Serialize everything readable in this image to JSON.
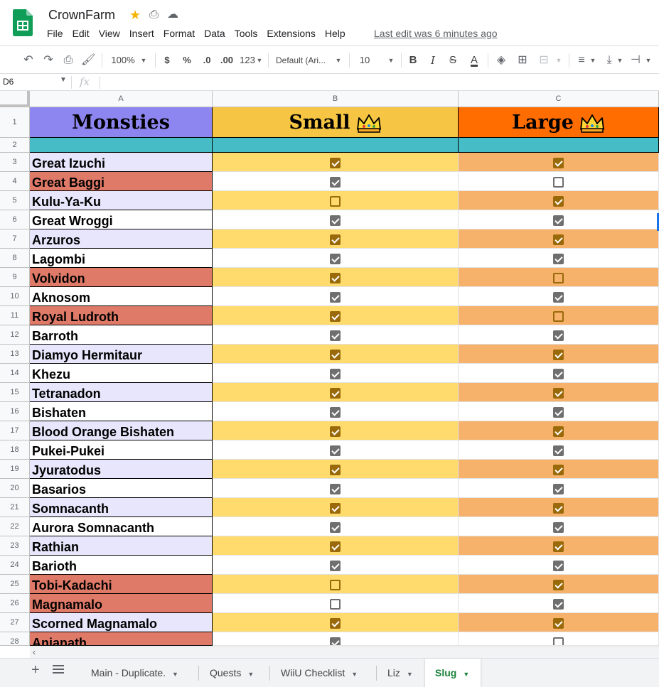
{
  "header": {
    "doc_title": "CrownFarm",
    "menu": [
      "File",
      "Edit",
      "View",
      "Insert",
      "Format",
      "Data",
      "Tools",
      "Extensions",
      "Help"
    ],
    "last_edit": "Last edit was 6 minutes ago"
  },
  "toolbar": {
    "zoom": "100%",
    "currency": "$",
    "percent": "%",
    "decrease_decimal": ".0",
    "increase_decimal": ".00",
    "number_format": "123",
    "font": "Default (Ari...",
    "font_size": "10",
    "bold": "B",
    "italic": "I",
    "strike": "S",
    "text_color": "A"
  },
  "formula_bar": {
    "name_box": "D6",
    "fx": "fx"
  },
  "columns": [
    "A",
    "B",
    "C"
  ],
  "sheet": {
    "header_row": {
      "a": "Monsties",
      "b": "Small",
      "c": "Large"
    },
    "rows": [
      {
        "num": "3",
        "name": "Great Izuchi",
        "small": true,
        "large": true,
        "red": false
      },
      {
        "num": "4",
        "name": "Great Baggi",
        "small": true,
        "large": false,
        "red": true
      },
      {
        "num": "5",
        "name": "Kulu-Ya-Ku",
        "small": false,
        "large": true,
        "red": false
      },
      {
        "num": "6",
        "name": "Great Wroggi",
        "small": true,
        "large": true,
        "red": false
      },
      {
        "num": "7",
        "name": "Arzuros",
        "small": true,
        "large": true,
        "red": false
      },
      {
        "num": "8",
        "name": "Lagombi",
        "small": true,
        "large": true,
        "red": false
      },
      {
        "num": "9",
        "name": "Volvidon",
        "small": true,
        "large": false,
        "red": true
      },
      {
        "num": "10",
        "name": "Aknosom",
        "small": true,
        "large": true,
        "red": false
      },
      {
        "num": "11",
        "name": "Royal Ludroth",
        "small": true,
        "large": false,
        "red": true
      },
      {
        "num": "12",
        "name": "Barroth",
        "small": true,
        "large": true,
        "red": false
      },
      {
        "num": "13",
        "name": "Diamyo Hermitaur",
        "small": true,
        "large": true,
        "red": false
      },
      {
        "num": "14",
        "name": "Khezu",
        "small": true,
        "large": true,
        "red": false
      },
      {
        "num": "15",
        "name": "Tetranadon",
        "small": true,
        "large": true,
        "red": false
      },
      {
        "num": "16",
        "name": "Bishaten",
        "small": true,
        "large": true,
        "red": false
      },
      {
        "num": "17",
        "name": "Blood Orange Bishaten",
        "small": true,
        "large": true,
        "red": false
      },
      {
        "num": "18",
        "name": "Pukei-Pukei",
        "small": true,
        "large": true,
        "red": false
      },
      {
        "num": "19",
        "name": "Jyuratodus",
        "small": true,
        "large": true,
        "red": false
      },
      {
        "num": "20",
        "name": "Basarios",
        "small": true,
        "large": true,
        "red": false
      },
      {
        "num": "21",
        "name": "Somnacanth",
        "small": true,
        "large": true,
        "red": false
      },
      {
        "num": "22",
        "name": "Aurora Somnacanth",
        "small": true,
        "large": true,
        "red": false
      },
      {
        "num": "23",
        "name": "Rathian",
        "small": true,
        "large": true,
        "red": false
      },
      {
        "num": "24",
        "name": "Barioth",
        "small": true,
        "large": true,
        "red": false
      },
      {
        "num": "25",
        "name": "Tobi-Kadachi",
        "small": false,
        "large": true,
        "red": true
      },
      {
        "num": "26",
        "name": "Magnamalo",
        "small": false,
        "large": true,
        "red": true
      },
      {
        "num": "27",
        "name": "Scorned Magnamalo",
        "small": true,
        "large": true,
        "red": false
      },
      {
        "num": "28",
        "name": "Anjanath",
        "small": true,
        "large": false,
        "red": true
      }
    ]
  },
  "tabs": [
    {
      "label": "Main - Duplicate.",
      "active": false
    },
    {
      "label": "Quests",
      "active": false
    },
    {
      "label": "WiiU Checklist",
      "active": false
    },
    {
      "label": "Liz",
      "active": false
    },
    {
      "label": "Slug",
      "active": true
    }
  ],
  "colors": {
    "header_a": "#8e86f0",
    "header_b": "#f6c543",
    "header_c": "#ff6d01",
    "teal": "#46bdc6",
    "name_light": "#e8e6fc",
    "name_red": "#e07a68",
    "yellow": "#fedb6c",
    "orange": "#f6b26b",
    "checked_on_color": "#9a6a0a",
    "checked_on_white": "#6f6f6f",
    "active_tab": "#188038"
  }
}
